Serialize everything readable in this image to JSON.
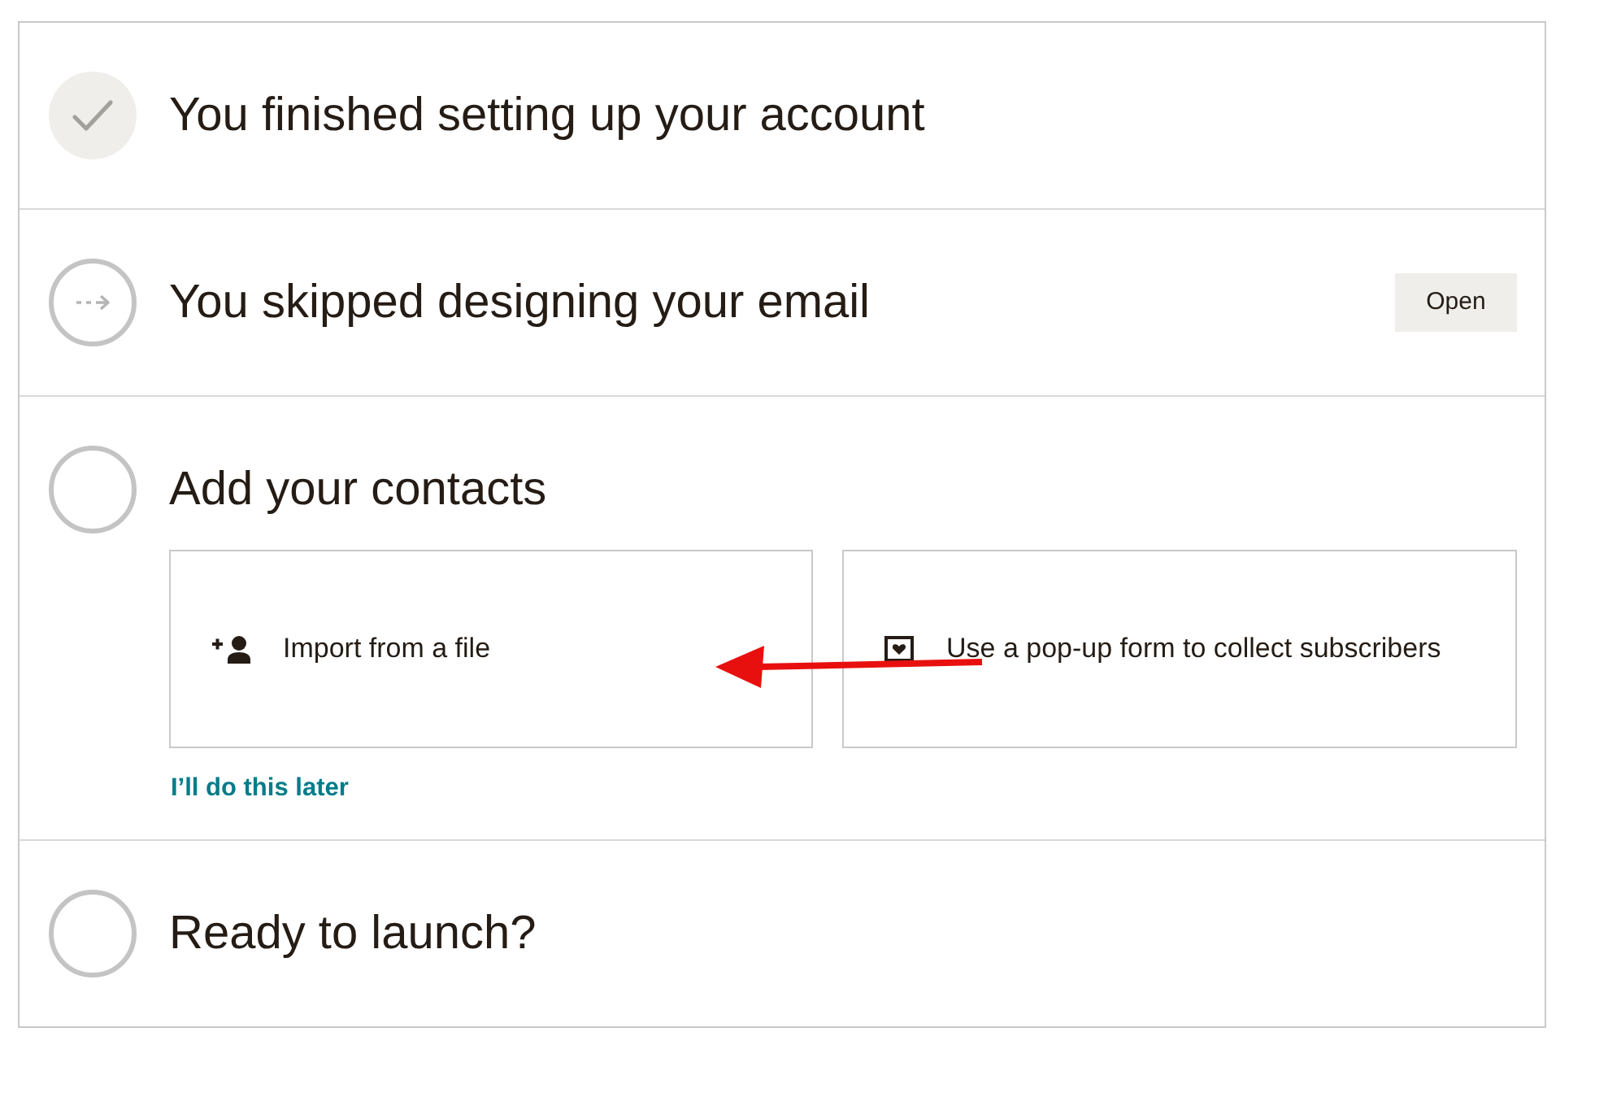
{
  "steps": [
    {
      "title": "You finished setting up your account",
      "completed": true,
      "skipped": false
    },
    {
      "title": "You skipped designing your email",
      "completed": false,
      "skipped": true,
      "button": "Open"
    },
    {
      "title": "Add your contacts",
      "completed": false,
      "skipped": false,
      "options": [
        {
          "label": "Import from a file",
          "kind": "import"
        },
        {
          "label": "Use a pop-up form to collect subscribers",
          "kind": "popup_form"
        }
      ],
      "link": "I’ll do this later"
    },
    {
      "title": "Ready to launch?",
      "completed": false,
      "skipped": false
    }
  ]
}
